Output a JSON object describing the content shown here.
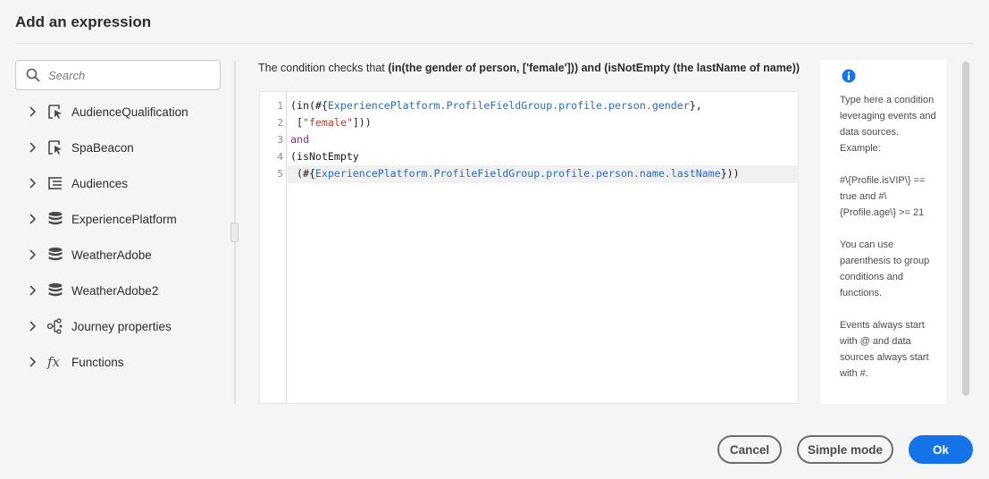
{
  "dialog": {
    "title": "Add an expression"
  },
  "search": {
    "placeholder": "Search",
    "value": ""
  },
  "sidebar": {
    "items": [
      {
        "label": "AudienceQualification",
        "icon": "event-pointer-icon"
      },
      {
        "label": "SpaBeacon",
        "icon": "event-pointer-icon"
      },
      {
        "label": "Audiences",
        "icon": "list-icon"
      },
      {
        "label": "ExperiencePlatform",
        "icon": "database-icon"
      },
      {
        "label": "WeatherAdobe",
        "icon": "database-icon"
      },
      {
        "label": "WeatherAdobe2",
        "icon": "database-icon"
      },
      {
        "label": "Journey properties",
        "icon": "properties-icon"
      },
      {
        "label": "Functions",
        "icon": "function-icon"
      }
    ]
  },
  "condition": {
    "prefix": "The condition checks that ",
    "summary": "(in(the gender of person, ['female'])) and (isNotEmpty (the lastName of name))"
  },
  "editor": {
    "line_numbers": [
      "1",
      "2",
      "3",
      "4",
      "5"
    ],
    "lines": [
      {
        "p1": "(in(#{",
        "field": "ExperiencePlatform.ProfileFieldGroup.profile.person.gender",
        "p2": "},",
        "str": "",
        "p3": ""
      },
      {
        "p1": " [",
        "field": "",
        "p2": "",
        "str": "\"female\"",
        "p3": "]))"
      },
      {
        "kw": "and"
      },
      {
        "p1": "(isNotEmpty",
        "field": "",
        "p2": "",
        "str": "",
        "p3": ""
      },
      {
        "p1": " (#{",
        "field": "ExperiencePlatform.ProfileFieldGroup.profile.person.name.lastName",
        "p2": "}))",
        "str": "",
        "p3": ""
      }
    ]
  },
  "help": {
    "icon": "info-icon",
    "text": "Type here a condition leveraging events and data sources. Example:\n\n#\\{Profile.isVIP\\} == true and #\\{Profile.age\\} >= 21\n\nYou can use parenthesis to group conditions and functions.\n\nEvents always start with @ and data sources always start with #."
  },
  "footer": {
    "cancel_label": "Cancel",
    "simple_mode_label": "Simple mode",
    "ok_label": "Ok"
  },
  "colors": {
    "accent": "#1473e6",
    "keyword": "#8a2c8c",
    "field": "#2a6bbf",
    "string": "#c0392b"
  }
}
